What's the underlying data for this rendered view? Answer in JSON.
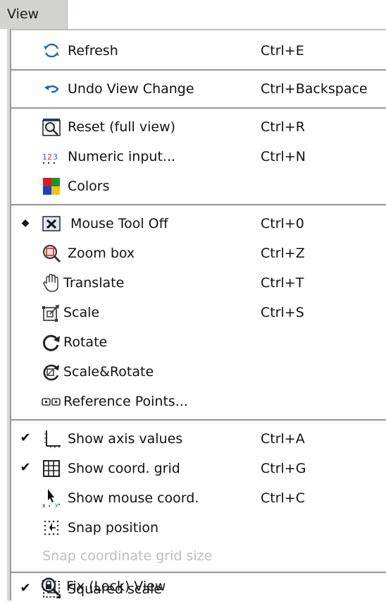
{
  "menu_title": "View",
  "colors": {
    "separator": "#9a9a9a",
    "disabled_text": "#bdbdbd",
    "menubar_bg": "#d3d3cf"
  },
  "items": [
    {
      "label": "Refresh",
      "shortcut": "Ctrl+E",
      "icon": "refresh-icon"
    },
    {
      "label": "Undo View Change",
      "shortcut": "Ctrl+Backspace",
      "icon": "undo-icon"
    },
    {
      "label": "Reset (full view)",
      "shortcut": "Ctrl+R",
      "icon": "reset-view-icon"
    },
    {
      "label": "Numeric input...",
      "shortcut": "Ctrl+N",
      "icon": "numeric-input-icon"
    },
    {
      "label": "Colors",
      "shortcut": "",
      "icon": "colors-icon"
    },
    {
      "label": "Mouse Tool Off",
      "shortcut": "Ctrl+0",
      "icon": "mouse-tool-off-icon",
      "mark": "◆"
    },
    {
      "label": "Zoom box",
      "shortcut": "Ctrl+Z",
      "icon": "zoom-box-icon"
    },
    {
      "label": "Translate",
      "shortcut": "Ctrl+T",
      "icon": "hand-icon"
    },
    {
      "label": "Scale",
      "shortcut": "Ctrl+S",
      "icon": "scale-icon"
    },
    {
      "label": "Rotate",
      "shortcut": "",
      "icon": "rotate-icon"
    },
    {
      "label": "Scale&Rotate",
      "shortcut": "",
      "icon": "scale-rotate-icon"
    },
    {
      "label": "Reference Points...",
      "shortcut": "",
      "icon": "reference-points-icon"
    },
    {
      "label": "Show axis values",
      "shortcut": "Ctrl+A",
      "icon": "axis-values-icon",
      "mark": "✔"
    },
    {
      "label": "Show coord. grid",
      "shortcut": "Ctrl+G",
      "icon": "grid-icon",
      "mark": "✔"
    },
    {
      "label": "Show mouse coord.",
      "shortcut": "Ctrl+C",
      "icon": "mouse-coord-icon"
    },
    {
      "label": "Snap position",
      "shortcut": "",
      "icon": "snap-icon"
    },
    {
      "label": "Snap coordinate grid size",
      "shortcut": "",
      "disabled": true
    },
    {
      "label": "Squared scale",
      "shortcut": "",
      "icon": "squared-scale-icon",
      "mark": "✔"
    },
    {
      "label": "Fix (Lock) View",
      "shortcut": "",
      "icon": "lock-view-icon"
    }
  ]
}
